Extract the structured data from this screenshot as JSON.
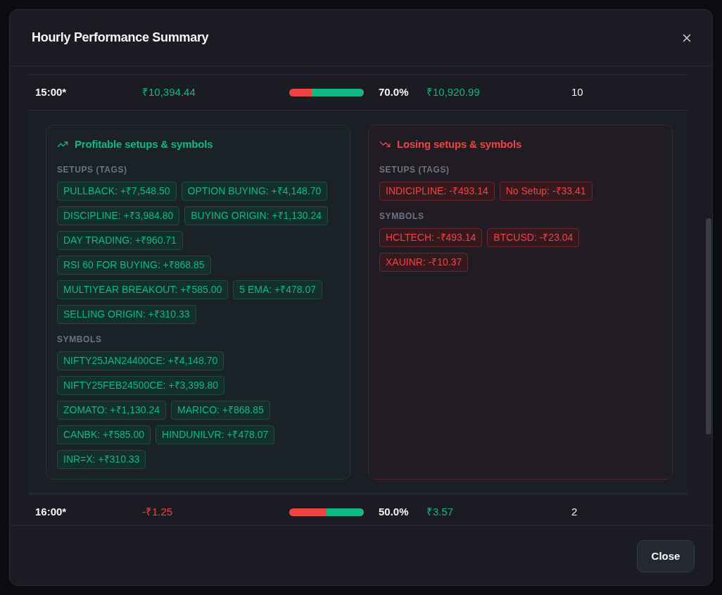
{
  "dialog": {
    "title": "Hourly Performance Summary",
    "close_button": "Close"
  },
  "rows": [
    {
      "cells": [
        {
          "kind": "label",
          "text": "15:00*"
        },
        {
          "kind": "amount",
          "text": "₹10,394.44",
          "positive": true
        },
        {
          "kind": "bar",
          "level": 0.7
        },
        {
          "kind": "label",
          "text": "70.0%"
        },
        {
          "kind": "amount",
          "text": "₹10,920.99",
          "positive": true
        },
        {
          "kind": "count",
          "text": "10"
        }
      ],
      "panels": [
        {
          "kind": "profit",
          "title": "Profitable setups & symbols",
          "groups": [
            {
              "label": "SETUPS (TAGS)",
              "chips": [
                "PULLBACK: +₹7,548.50",
                "OPTION BUYING: +₹4,148.70",
                "DISCIPLINE: +₹3,984.80",
                "BUYING ORIGIN: +₹1,130.24",
                "DAY TRADING: +₹960.71",
                "RSI 60 FOR BUYING: +₹868.85",
                "MULTIYEAR BREAKOUT: +₹585.00",
                "5 EMA: +₹478.07",
                "SELLING ORIGIN: +₹310.33"
              ]
            },
            {
              "label": "SYMBOLS",
              "chips": [
                "NIFTY25JAN24400CE: +₹4,148.70",
                "NIFTY25FEB24500CE: +₹3,399.80",
                "ZOMATO: +₹1,130.24",
                "MARICO: +₹868.85",
                "CANBK: +₹585.00",
                "HINDUNILVR: +₹478.07",
                "INR=X: +₹310.33"
              ]
            }
          ]
        },
        {
          "kind": "loss",
          "title": "Losing setups & symbols",
          "groups": [
            {
              "label": "SETUPS (TAGS)",
              "chips": [
                "INDICIPLINE: -₹493.14",
                "No Setup: -₹33.41"
              ]
            },
            {
              "label": "SYMBOLS",
              "chips": [
                "HCLTECH: -₹493.14",
                "BTCUSD: -₹23.04",
                "XAUINR: -₹10.37"
              ]
            }
          ]
        }
      ]
    },
    {
      "cells": [
        {
          "kind": "label",
          "text": "16:00*"
        },
        {
          "kind": "amount",
          "text": "-₹1.25",
          "positive": false
        },
        {
          "kind": "bar",
          "level": 0.5
        },
        {
          "kind": "label",
          "text": "50.0%"
        },
        {
          "kind": "amount",
          "text": "₹3.57",
          "positive": true
        },
        {
          "kind": "count",
          "text": "2"
        }
      ]
    }
  ]
}
